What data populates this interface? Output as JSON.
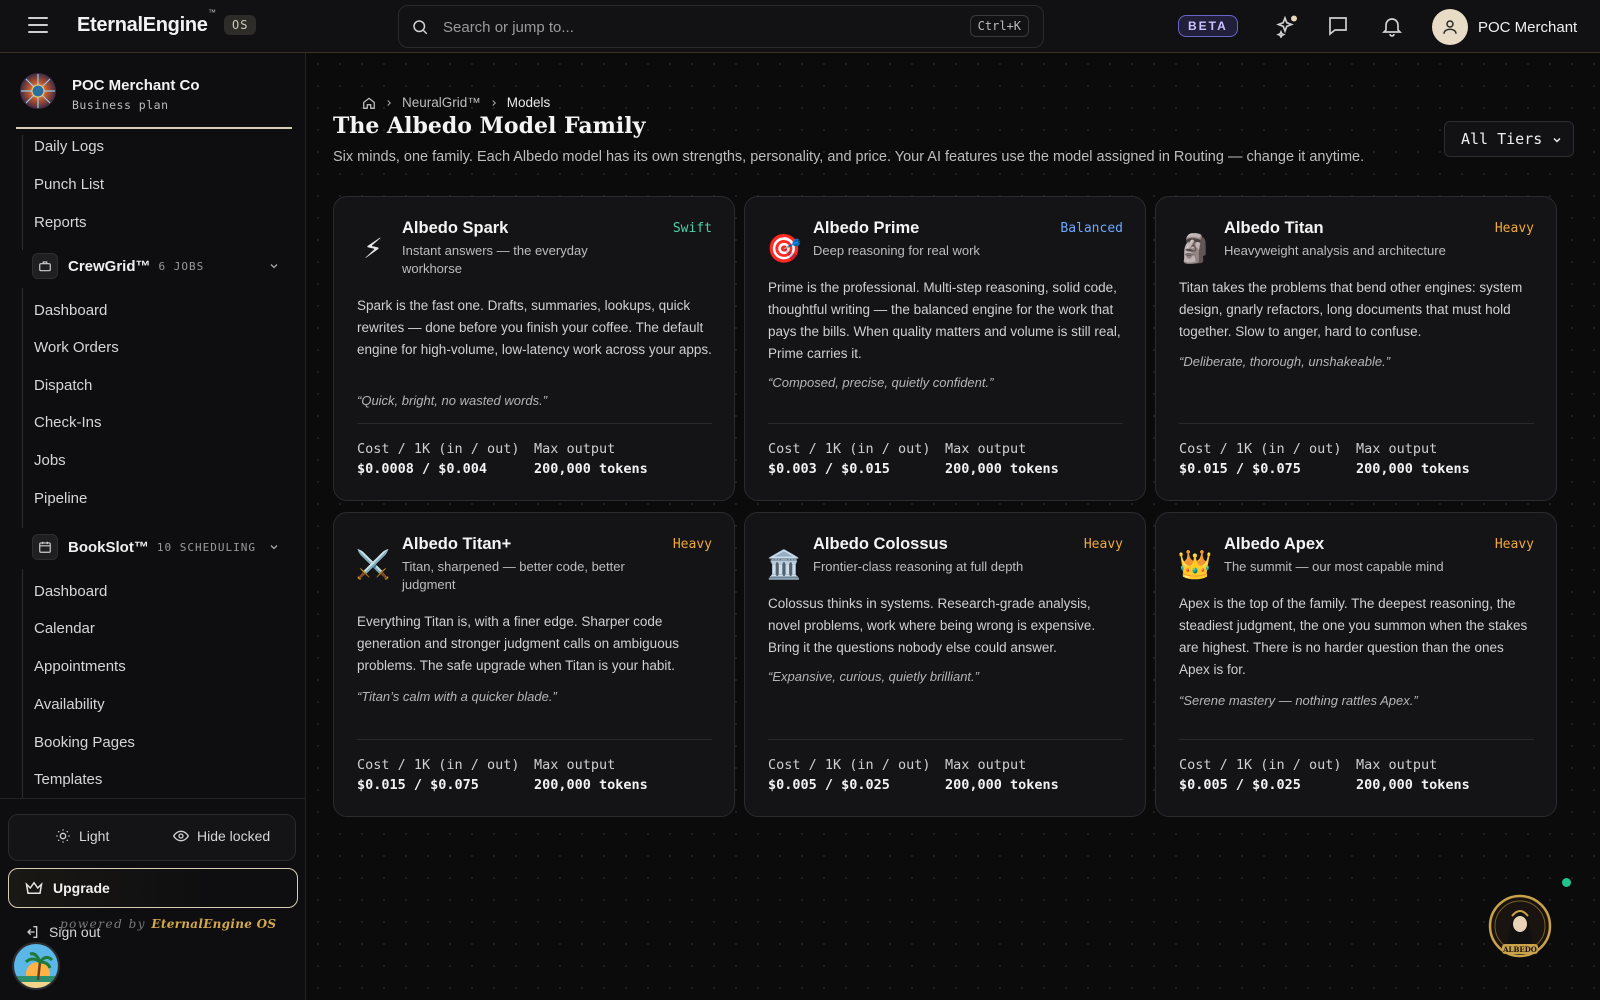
{
  "topbar": {
    "brand": "EternalEngine",
    "brand_tm": "™",
    "brand_os": "OS",
    "search_placeholder": "Search or jump to...",
    "search_shortcut": "Ctrl+K",
    "beta_label": "BETA",
    "user_name": "POC Merchant"
  },
  "sidebar": {
    "org_name": "POC Merchant Co",
    "org_plan": "Business plan",
    "items_top": [
      "Daily Logs",
      "Punch List",
      "Reports"
    ],
    "group_crewgrid": {
      "label": "CrewGrid™",
      "meta": "6 JOBS",
      "items": [
        "Dashboard",
        "Work Orders",
        "Dispatch",
        "Check-Ins",
        "Jobs",
        "Pipeline"
      ]
    },
    "group_bookslot": {
      "label": "BookSlot™",
      "meta": "10 SCHEDULING",
      "items": [
        "Dashboard",
        "Calendar",
        "Appointments",
        "Availability",
        "Booking Pages",
        "Templates"
      ]
    },
    "light_label": "Light",
    "hide_locked_label": "Hide locked",
    "upgrade_label": "Upgrade",
    "signout_label": "Sign out",
    "powered_prefix": "powered by",
    "powered_brand": "EternalEngine OS"
  },
  "main": {
    "breadcrumb": [
      "NeuralGrid™",
      "Models"
    ],
    "title": "The Albedo Model Family",
    "subtitle": "Six minds, one family. Each Albedo model has its own strengths, personality, and price. Your AI features use the model assigned in Routing — change it anytime.",
    "tier_filter": "All Tiers",
    "cost_label": "Cost / 1K (in / out)",
    "max_label": "Max output",
    "models": [
      {
        "icon": "lightning-icon",
        "glyph": "⚡",
        "name": "Albedo Spark",
        "tier": "Swift",
        "tier_color": "#4fd1a5",
        "tagline": "Instant answers — the everyday workhorse",
        "description": "Spark is the fast one. Drafts, summaries, lookups, quick rewrites — done before you finish your coffee. The default engine for high-volume, low-latency work across your apps.",
        "quote": "“Quick, bright, no wasted words.”",
        "cost": "$0.0008 / $0.004",
        "max_output": "200,000 tokens"
      },
      {
        "icon": "target-icon",
        "glyph": "🎯",
        "name": "Albedo Prime",
        "tier": "Balanced",
        "tier_color": "#6ca8ff",
        "tagline": "Deep reasoning for real work",
        "description": "Prime is the professional. Multi-step reasoning, solid code, thoughtful writing — the balanced engine for the work that pays the bills. When quality matters and volume is still real, Prime carries it.",
        "quote": "“Composed, precise, quietly confident.”",
        "cost": "$0.003 / $0.015",
        "max_output": "200,000 tokens"
      },
      {
        "icon": "statue-icon",
        "glyph": "🗿",
        "name": "Albedo Titan",
        "tier": "Heavy",
        "tier_color": "#f0a93b",
        "tagline": "Heavyweight analysis and architecture",
        "description": "Titan takes the problems that bend other engines: system design, gnarly refactors, long documents that must hold together. Slow to anger, hard to confuse.",
        "quote": "“Deliberate, thorough, unshakeable.”",
        "cost": "$0.015 / $0.075",
        "max_output": "200,000 tokens"
      },
      {
        "icon": "crossed-swords-icon",
        "glyph": "⚔️",
        "name": "Albedo Titan+",
        "tier": "Heavy",
        "tier_color": "#f0a93b",
        "tagline": "Titan, sharpened — better code, better judgment",
        "description": "Everything Titan is, with a finer edge. Sharper code generation and stronger judgment calls on ambiguous problems. The safe upgrade when Titan is your habit.",
        "quote": "“Titan’s calm with a quicker blade.”",
        "cost": "$0.015 / $0.075",
        "max_output": "200,000 tokens"
      },
      {
        "icon": "classical-building-icon",
        "glyph": "🏛️",
        "name": "Albedo Colossus",
        "tier": "Heavy",
        "tier_color": "#f0a93b",
        "tagline": "Frontier-class reasoning at full depth",
        "description": "Colossus thinks in systems. Research-grade analysis, novel problems, work where being wrong is expensive. Bring it the questions nobody else could answer.",
        "quote": "“Expansive, curious, quietly brilliant.”",
        "cost": "$0.005 / $0.025",
        "max_output": "200,000 tokens"
      },
      {
        "icon": "crown-icon",
        "glyph": "👑",
        "name": "Albedo Apex",
        "tier": "Heavy",
        "tier_color": "#f0a93b",
        "tagline": "The summit — our most capable mind",
        "description": "Apex is the top of the family. The deepest reasoning, the steadiest judgment, the one you summon when the stakes are highest. There is no harder question than the ones Apex is for.",
        "quote": "“Serene mastery — nothing rattles Apex.”",
        "cost": "$0.005 / $0.025",
        "max_output": "200,000 tokens"
      }
    ],
    "assistant_badge": "ALBEDO"
  }
}
